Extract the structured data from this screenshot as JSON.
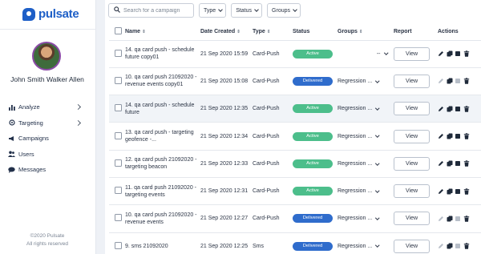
{
  "brand": {
    "name": "pulsate",
    "color": "#1e5fc7"
  },
  "user": {
    "name": "John Smith Walker Allen"
  },
  "nav": [
    {
      "label": "Analyze",
      "icon": "bar-chart-icon",
      "has_submenu": true
    },
    {
      "label": "Targeting",
      "icon": "crosshair-icon",
      "has_submenu": true
    },
    {
      "label": "Campaigns",
      "icon": "megaphone-icon",
      "has_submenu": false
    },
    {
      "label": "Users",
      "icon": "users-icon",
      "has_submenu": false
    },
    {
      "label": "Messages",
      "icon": "chat-bubble-icon",
      "has_submenu": false
    }
  ],
  "footer": {
    "copyright": "©2020 Pulsate",
    "rights": "All rights reserved"
  },
  "toolbar": {
    "search_placeholder": "Search for a campaign",
    "filters": [
      "Type",
      "Status",
      "Groups"
    ]
  },
  "table": {
    "headers": {
      "name": "Name",
      "date": "Date Created",
      "type": "Type",
      "status": "Status",
      "groups": "Groups",
      "report": "Report",
      "actions": "Actions"
    },
    "view_label": "View",
    "status_colors": {
      "Active": "#4cbe8b",
      "Delivered": "#2f6ccc"
    },
    "rows": [
      {
        "name": "14. qa card push - schedule future copy01",
        "date": "21 Sep 2020 15:59",
        "type": "Card-Push",
        "status": "Active",
        "groups": "--",
        "highlight": false,
        "edit_enabled": true
      },
      {
        "name": "10. qa card push 21092020 - revenue events copy01",
        "date": "21 Sep 2020 15:08",
        "type": "Card-Push",
        "status": "Delivered",
        "groups": "Regression ...",
        "highlight": false,
        "edit_enabled": false
      },
      {
        "name": "14. qa card push - schedule future",
        "date": "21 Sep 2020 12:35",
        "type": "Card-Push",
        "status": "Active",
        "groups": "Regression ...",
        "highlight": true,
        "edit_enabled": true
      },
      {
        "name": "13. qa card push - targeting geofence -...",
        "date": "21 Sep 2020 12:34",
        "type": "Card-Push",
        "status": "Active",
        "groups": "Regression ...",
        "highlight": false,
        "edit_enabled": true
      },
      {
        "name": "12. qa card push 21092020 - targeting beacon",
        "date": "21 Sep 2020 12:33",
        "type": "Card-Push",
        "status": "Active",
        "groups": "Regression ...",
        "highlight": false,
        "edit_enabled": true
      },
      {
        "name": "11. qa card push 21092020 - targeting events",
        "date": "21 Sep 2020 12:31",
        "type": "Card-Push",
        "status": "Active",
        "groups": "Regression ...",
        "highlight": false,
        "edit_enabled": true
      },
      {
        "name": "10. qa card push 21092020 - revenue events",
        "date": "21 Sep 2020 12:27",
        "type": "Card-Push",
        "status": "Delivered",
        "groups": "Regression ...",
        "highlight": false,
        "edit_enabled": false
      },
      {
        "name": "9. sms 21092020",
        "date": "21 Sep 2020 12:25",
        "type": "Sms",
        "status": "Delivered",
        "groups": "Regression ...",
        "highlight": false,
        "edit_enabled": false
      }
    ]
  }
}
